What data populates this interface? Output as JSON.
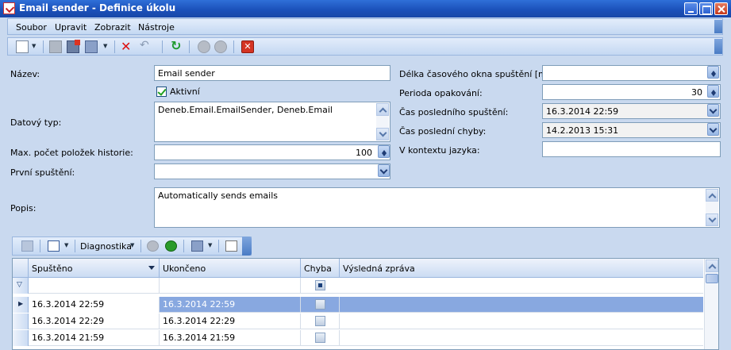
{
  "window": {
    "title": "Email sender - Definice úkolu"
  },
  "menu": {
    "items": [
      "Soubor",
      "Upravit",
      "Zobrazit",
      "Nástroje"
    ]
  },
  "toolbar": {
    "icons": [
      "new-document-icon",
      "save-icon",
      "save-close-icon",
      "copy-icon",
      "delete-icon",
      "undo-icon",
      "refresh-icon",
      "move-up-icon",
      "move-down-icon",
      "close-red-icon"
    ]
  },
  "form": {
    "nazev_label": "Název:",
    "nazev_value": "Email sender",
    "aktivni_label": "Aktivní",
    "aktivni_checked": true,
    "datovy_typ_label": "Datový typ:",
    "datovy_typ_value": "Deneb.Email.EmailSender, Deneb.Email",
    "max_pocet_label": "Max. počet položek historie:",
    "max_pocet_value": "100",
    "prvni_spusteni_label": "První spuštění:",
    "prvni_spusteni_value": "",
    "popis_label": "Popis:",
    "popis_value": "Automatically sends emails",
    "delka_label": "Délka časového okna spuštění [min]:",
    "delka_value": "",
    "perioda_label": "Perioda opakování:",
    "perioda_value": "30",
    "cas_posledniho_label": "Čas posledního spuštění:",
    "cas_posledniho_value": "16.3.2014 22:59",
    "cas_chyby_label": "Čas poslední chyby:",
    "cas_chyby_value": "14.2.2013 15:31",
    "kontext_label": "V kontextu jazyka:",
    "kontext_value": ""
  },
  "grid_toolbar": {
    "diagnostika_label": "Diagnostika"
  },
  "grid": {
    "columns": [
      "Spuštěno",
      "Ukončeno",
      "Chyba",
      "Výsledná zpráva"
    ],
    "rows": [
      {
        "spusteno": "16.3.2014 22:59",
        "ukonceno": "16.3.2014 22:59",
        "chyba": false,
        "zprava": ""
      },
      {
        "spusteno": "16.3.2014 22:29",
        "ukonceno": "16.3.2014 22:29",
        "chyba": false,
        "zprava": ""
      },
      {
        "spusteno": "16.3.2014 21:59",
        "ukonceno": "16.3.2014 21:59",
        "chyba": false,
        "zprava": ""
      }
    ],
    "selected_row": 0
  },
  "colors": {
    "titlebar": "#1a4fb8",
    "selection": "#88a8e0",
    "background": "#c9d9ef"
  }
}
